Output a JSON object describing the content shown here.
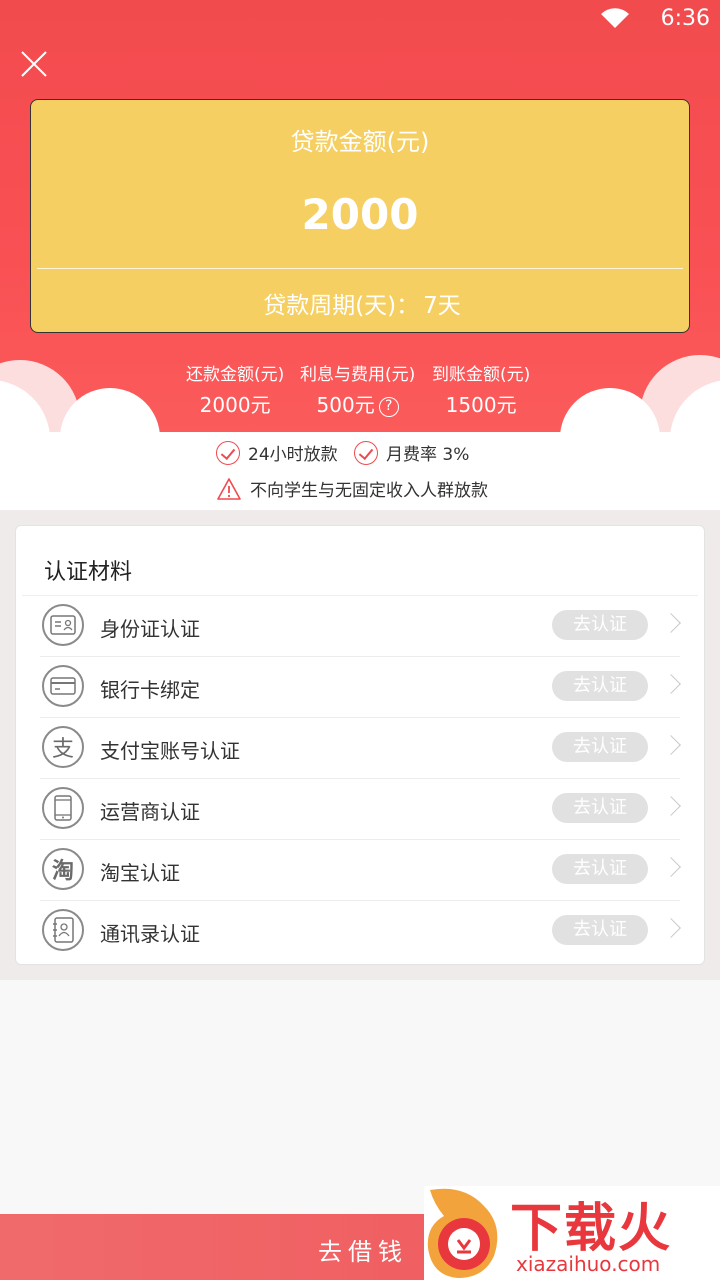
{
  "status_bar": {
    "time": "6:36"
  },
  "loan": {
    "amount_label": "贷款金额(元)",
    "amount": "2000",
    "period_label": "贷款周期(天)：",
    "period_value": "7天"
  },
  "summary": [
    {
      "label": "还款金额(元)",
      "value": "2000元"
    },
    {
      "label": "利息与费用(元)",
      "value": "500元"
    },
    {
      "label": "到账金额(元)",
      "value": "1500元"
    }
  ],
  "help_symbol": "?",
  "features": {
    "items": [
      "24小时放款",
      "月费率 3%"
    ],
    "warning": "不向学生与无固定收入人群放款"
  },
  "certification": {
    "title": "认证材料",
    "action_label": "去认证",
    "items": [
      {
        "label": "身份证认证",
        "icon": "id-card-icon"
      },
      {
        "label": "银行卡绑定",
        "icon": "bank-card-icon"
      },
      {
        "label": "支付宝账号认证",
        "icon": "alipay-icon"
      },
      {
        "label": "运营商认证",
        "icon": "phone-icon"
      },
      {
        "label": "淘宝认证",
        "icon": "taobao-icon"
      },
      {
        "label": "通讯录认证",
        "icon": "contacts-icon"
      }
    ]
  },
  "alipay_glyph": "支",
  "taobao_glyph": "淘",
  "bottom": {
    "borrow_label": "去借钱"
  },
  "watermark": {
    "brand": "下载火",
    "domain": "xiazaihuo.com"
  },
  "colors": {
    "primary_red": "#f95054",
    "card_yellow": "#f6cf62",
    "button_gray": "#e1e1e1"
  }
}
